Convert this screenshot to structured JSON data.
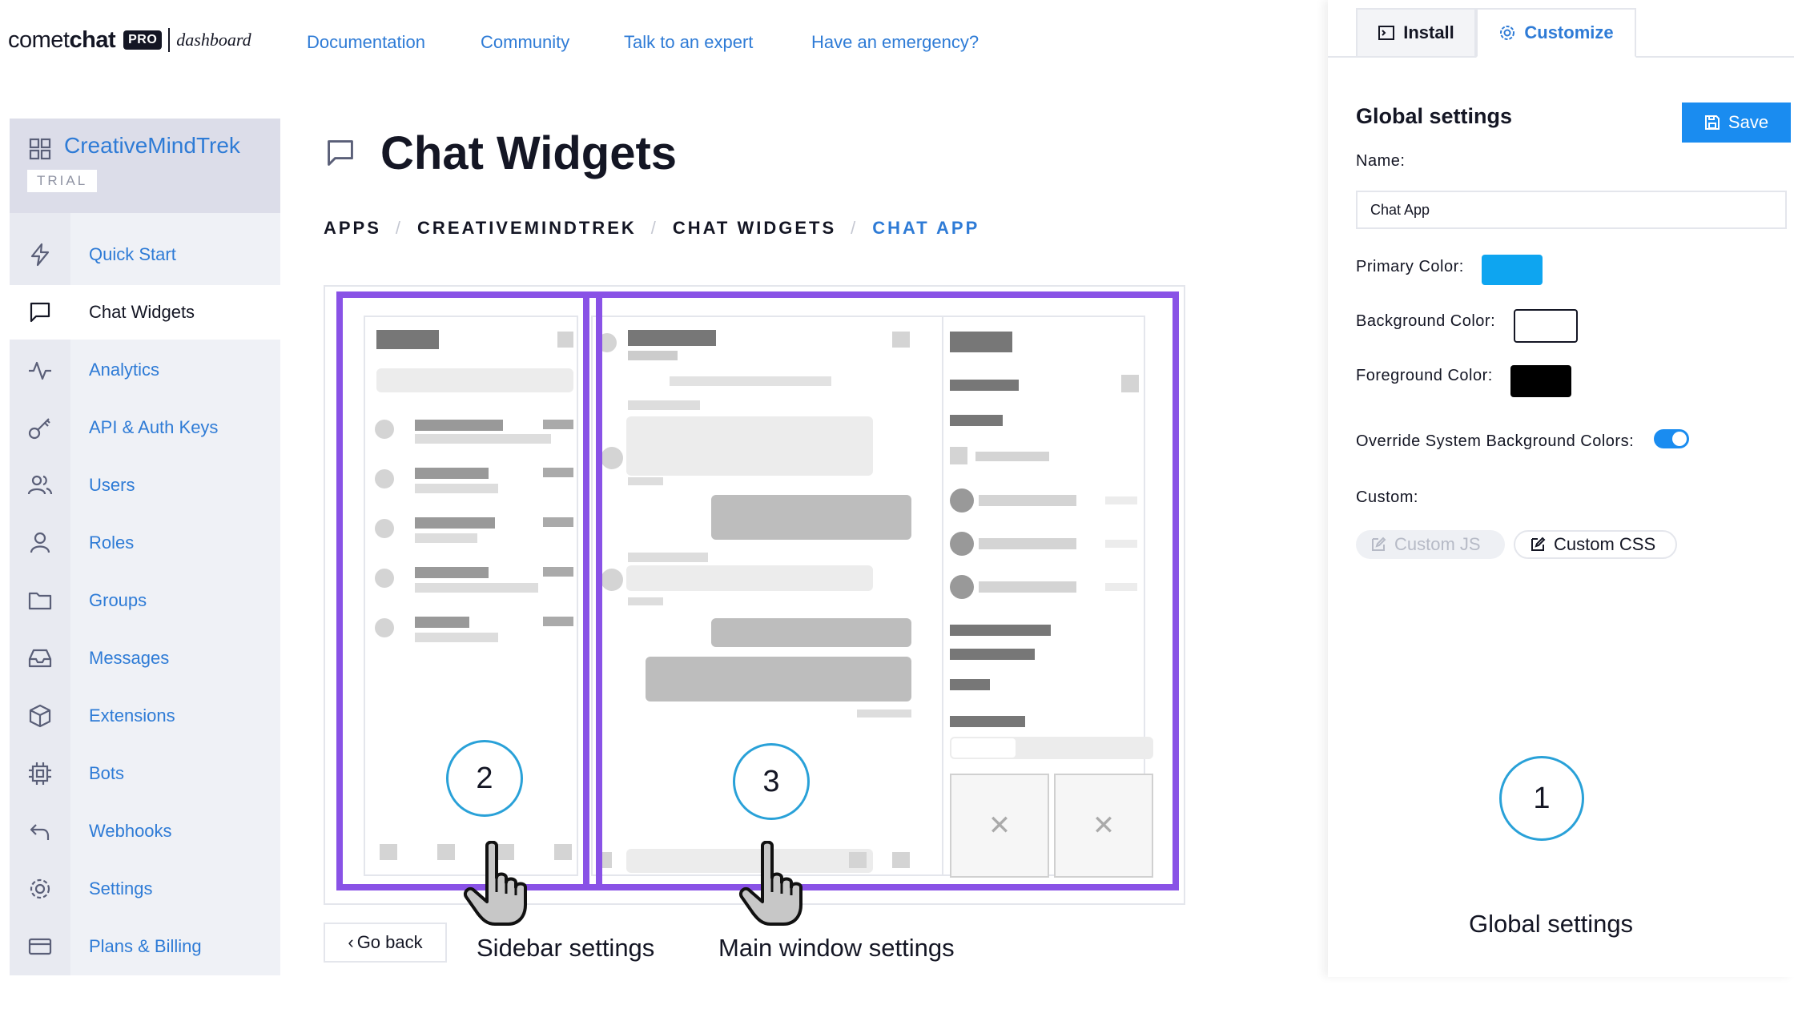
{
  "header": {
    "brand_light": "comet",
    "brand_bold": "chat",
    "pro_badge": "PRO",
    "dashboard": "dashboard",
    "nav": [
      "Documentation",
      "Community",
      "Talk to an expert",
      "Have an emergency?"
    ]
  },
  "sidebar": {
    "org_name": "CreativeMindTrek",
    "org_badge": "TRIAL",
    "items": [
      {
        "label": "Quick Start",
        "icon": "lightning-icon"
      },
      {
        "label": "Chat Widgets",
        "icon": "chat-bubble-icon",
        "active": true
      },
      {
        "label": "Analytics",
        "icon": "pulse-icon"
      },
      {
        "label": "API & Auth Keys",
        "icon": "key-icon"
      },
      {
        "label": "Users",
        "icon": "users-icon"
      },
      {
        "label": "Roles",
        "icon": "user-icon"
      },
      {
        "label": "Groups",
        "icon": "folder-icon"
      },
      {
        "label": "Messages",
        "icon": "inbox-icon"
      },
      {
        "label": "Extensions",
        "icon": "cube-icon"
      },
      {
        "label": "Bots",
        "icon": "chip-icon"
      },
      {
        "label": "Webhooks",
        "icon": "undo-arrow-icon"
      },
      {
        "label": "Settings",
        "icon": "gear-icon"
      },
      {
        "label": "Plans & Billing",
        "icon": "card-icon"
      }
    ]
  },
  "main": {
    "title": "Chat Widgets",
    "breadcrumb": [
      "APPS",
      "CREATIVEMINDTREK",
      "CHAT WIDGETS",
      "CHAT APP"
    ],
    "go_back": "Go back"
  },
  "annotations": {
    "sidebar_number": "2",
    "main_number": "3",
    "global_number": "1",
    "sidebar_caption": "Sidebar settings",
    "main_caption": "Main window settings",
    "global_caption": "Global settings",
    "highlight_color": "#8952e6"
  },
  "panel": {
    "tab_install": "Install",
    "tab_customize": "Customize",
    "title": "Global settings",
    "save_label": "Save",
    "name_label": "Name",
    "name_value": "Chat App",
    "primary_label": "Primary Color",
    "primary_color": "#0ea5f0",
    "background_label": "Background Color",
    "background_color": "#ffffff",
    "foreground_label": "Foreground Color",
    "foreground_color": "#000000",
    "override_label": "Override System Background Colors",
    "override_on": true,
    "custom_label": "Custom",
    "custom_js": "Custom JS",
    "custom_css": "Custom CSS",
    "colon": ":"
  }
}
